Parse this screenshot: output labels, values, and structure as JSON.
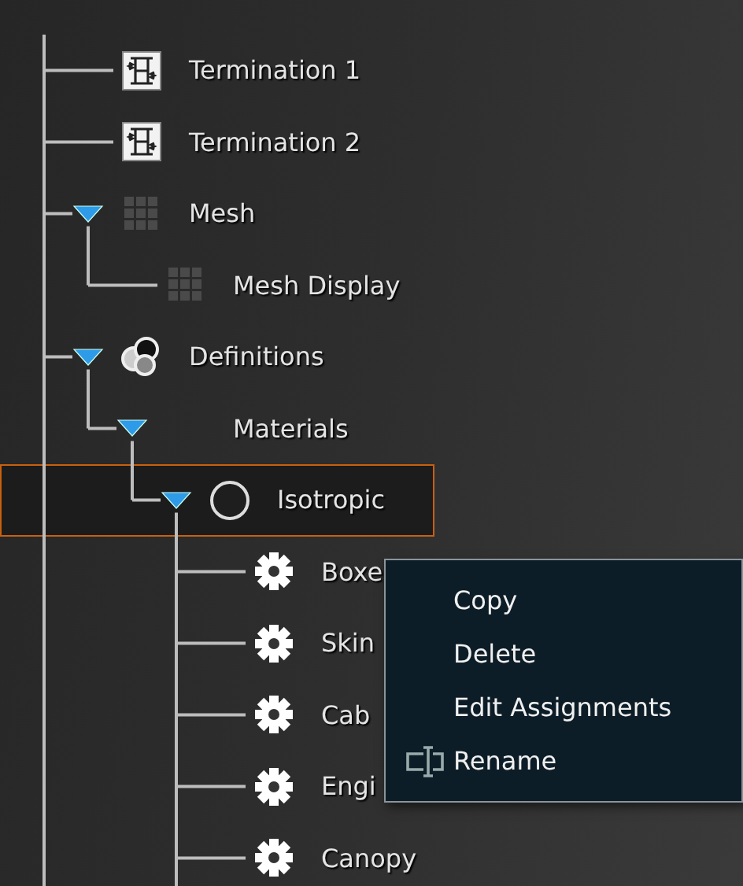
{
  "tree": [
    {
      "label": "Termination 1",
      "kind": "termination",
      "selected": false
    },
    {
      "label": "Termination 2",
      "kind": "termination",
      "selected": false
    },
    {
      "label": "Mesh",
      "kind": "mesh",
      "expanded": true,
      "selected": false,
      "children": [
        {
          "label": "Mesh Display",
          "kind": "mesh",
          "selected": false
        }
      ]
    },
    {
      "label": "Definitions",
      "kind": "definitions",
      "expanded": true,
      "selected": false,
      "children": [
        {
          "label": "Materials",
          "kind": "folder",
          "expanded": true,
          "selected": false,
          "children": [
            {
              "label": "Isotropic",
              "kind": "material",
              "expanded": true,
              "selected": true,
              "children": [
                {
                  "label": "Boxe",
                  "kind": "setting",
                  "selected": false
                },
                {
                  "label": "Skin",
                  "kind": "setting",
                  "selected": false
                },
                {
                  "label": "Cab",
                  "kind": "setting",
                  "selected": false
                },
                {
                  "label": "Engi",
                  "kind": "setting",
                  "selected": false
                },
                {
                  "label": "Canopy",
                  "kind": "setting",
                  "selected": false
                }
              ]
            }
          ]
        }
      ]
    }
  ],
  "context_menu": [
    {
      "label": "Copy",
      "kind": "plain"
    },
    {
      "label": "Delete",
      "kind": "plain"
    },
    {
      "label": "Edit Assignments",
      "kind": "plain"
    },
    {
      "label": "Rename",
      "kind": "rename"
    }
  ]
}
